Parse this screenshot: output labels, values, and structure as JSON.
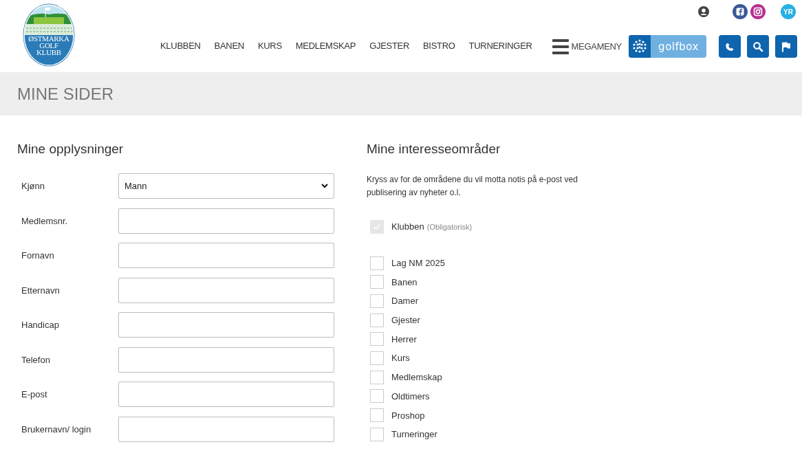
{
  "logo": {
    "lines": [
      "ØSTMARKA",
      "GOLF",
      "KLUBB"
    ]
  },
  "yr_badge": "YR",
  "nav": [
    "KLUBBEN",
    "BANEN",
    "KURS",
    "MEDLEMSKAP",
    "GJESTER",
    "BISTRO",
    "TURNERINGER"
  ],
  "megameny": "MEGAMENY",
  "golfbox": "golfbox",
  "page_title": "MINE SIDER",
  "profile": {
    "heading": "Mine opplysninger",
    "fields": [
      {
        "label": "Kjønn",
        "kind": "select",
        "value": "Mann"
      },
      {
        "label": "Medlemsnr.",
        "kind": "text"
      },
      {
        "label": "Fornavn",
        "kind": "text"
      },
      {
        "label": "Etternavn",
        "kind": "text"
      },
      {
        "label": "Handicap",
        "kind": "text"
      },
      {
        "label": "Telefon",
        "kind": "text"
      },
      {
        "label": "E-post",
        "kind": "text"
      },
      {
        "label": "Brukernavn/ login",
        "kind": "text"
      }
    ]
  },
  "interests": {
    "heading": "Mine interesseområder",
    "intro": "Kryss av for de områdene du vil motta notis på e-post ved publisering av nyheter o.l.",
    "required": {
      "label": "Klubben",
      "note": "(Obligatorisk)",
      "checked": true,
      "disabled": true
    },
    "items": [
      {
        "label": "Lag NM 2025",
        "checked": false
      },
      {
        "label": "Banen",
        "checked": false
      },
      {
        "label": "Damer",
        "checked": false
      },
      {
        "label": "Gjester",
        "checked": false
      },
      {
        "label": "Herrer",
        "checked": false
      },
      {
        "label": "Kurs",
        "checked": false
      },
      {
        "label": "Medlemskap",
        "checked": false
      },
      {
        "label": "Oldtimers",
        "checked": false
      },
      {
        "label": "Proshop",
        "checked": false
      },
      {
        "label": "Turneringer",
        "checked": false
      }
    ]
  }
}
